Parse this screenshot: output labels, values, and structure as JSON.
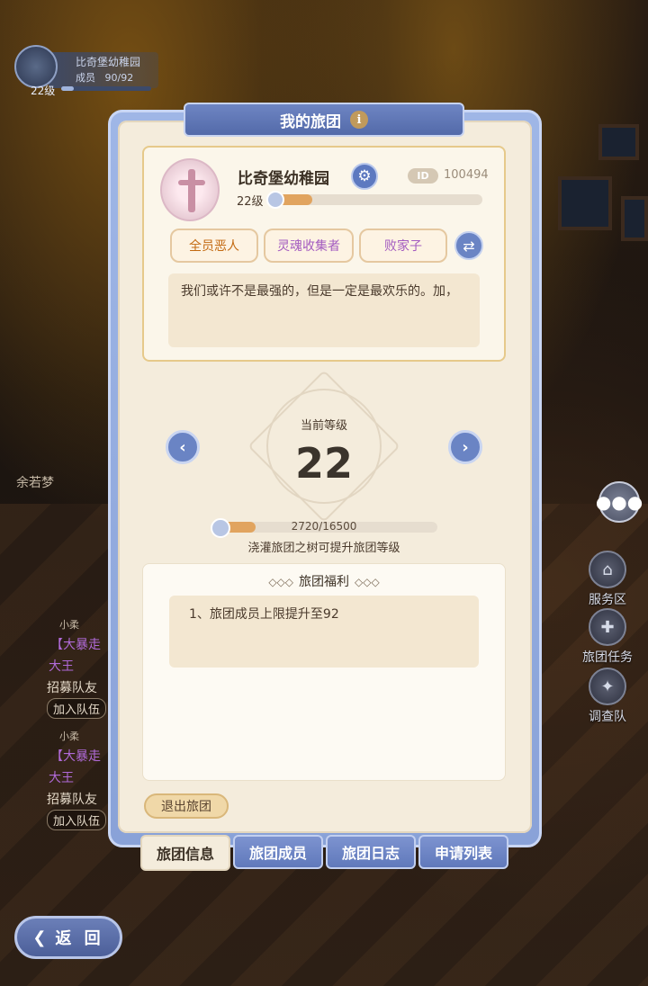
{
  "hud": {
    "guild_name": "比奇堡幼稚园",
    "members_label": "成员",
    "members_count": "90/92",
    "level": "22级"
  },
  "chat": {
    "npc_name": "余若梦",
    "messages": [
      {
        "sender": "小柔",
        "tag": "【大暴走",
        "title": "大王",
        "text": "招募队友",
        "button": "加入队伍"
      },
      {
        "sender": "小柔",
        "tag": "【大暴走",
        "title": "大王",
        "text": "招募队友",
        "button": "加入队伍"
      }
    ]
  },
  "side_menu": {
    "items": [
      {
        "label": "服务区",
        "icon": "shop-icon"
      },
      {
        "label": "旅团任务",
        "icon": "quest-icon"
      },
      {
        "label": "调查队",
        "icon": "wing-badge-icon"
      }
    ]
  },
  "back_button": {
    "label": "返 回"
  },
  "panel": {
    "title": "我的旅团",
    "guild": {
      "name": "比奇堡幼稚园",
      "id_label": "ID",
      "id_value": "100494",
      "level_label": "22级",
      "level_progress": 0.2,
      "tags": [
        "全员恶人",
        "灵魂收集者",
        "败家子"
      ],
      "motto": "我们或许不是最强的，但是一定是最欢乐的。加，"
    },
    "level": {
      "label": "当前等级",
      "value": "22",
      "exp_text": "2720/16500",
      "exp_fraction": 0.165,
      "hint": "浇灌旅团之树可提升旅团等级"
    },
    "benefits": {
      "title": "旅团福利",
      "items": [
        "1、旅团成员上限提升至92"
      ]
    },
    "leave_button": "退出旅团",
    "tabs": [
      "旅团信息",
      "旅团成员",
      "旅团日志",
      "申请列表"
    ],
    "active_tab": 0
  }
}
